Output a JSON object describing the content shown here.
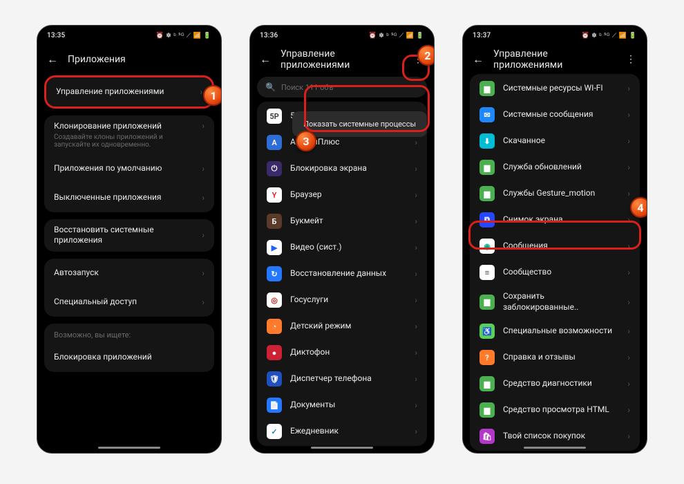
{
  "status_icons": "⏰ ✽ ᵇ ⁵ᴳ ⟋ 📶 🔋",
  "colors": {
    "red": "#d9201a",
    "orange_badge": "#e84a10"
  },
  "screen1": {
    "time": "13:35",
    "title": "Приложения",
    "rows": {
      "manage": "Управление приложениями",
      "clone": "Клонирование приложений",
      "clone_sub": "Создавайте клоны приложений и запускайте их одновременно.",
      "defaults": "Приложения по умолчанию",
      "disabled": "Выключенные приложения",
      "restore": "Восстановить системные приложения",
      "autostart": "Автозапуск",
      "special": "Специальный доступ",
      "hint": "Возможно, вы ищете:",
      "applock": "Блокировка приложений"
    }
  },
  "screen2": {
    "time": "13:36",
    "title": "Управление приложениями",
    "search_placeholder": "Поиск 111 объ",
    "popup": "Показать системные процессы",
    "apps": [
      {
        "name": "5Post",
        "bg": "#fff",
        "fg": "#333",
        "glyph": "5P"
      },
      {
        "name": "АптекиПлюс",
        "bg": "#2e6cd6",
        "fg": "#fff",
        "glyph": "А"
      },
      {
        "name": "Блокировка экрана",
        "bg": "#3b2a6b",
        "fg": "#fff",
        "glyph": "⏻"
      },
      {
        "name": "Браузер",
        "bg": "#fff",
        "fg": "#d22",
        "glyph": "Y"
      },
      {
        "name": "Букмейт",
        "bg": "#5b3a2a",
        "fg": "#fff",
        "glyph": "Б"
      },
      {
        "name": "Видео (сист.)",
        "bg": "#fff",
        "fg": "#1e60ff",
        "glyph": "▶"
      },
      {
        "name": "Восстановление данных",
        "bg": "#2477ff",
        "fg": "#fff",
        "glyph": "↻"
      },
      {
        "name": "Госуслуги",
        "bg": "#fff",
        "fg": "#c22",
        "glyph": "◎"
      },
      {
        "name": "Детский режим",
        "bg": "#ff7a2a",
        "fg": "#fff",
        "glyph": "◔"
      },
      {
        "name": "Диктофон",
        "bg": "#c23",
        "fg": "#fff",
        "glyph": "●"
      },
      {
        "name": "Диспетчер телефона",
        "bg": "#2050c0",
        "fg": "#fff",
        "glyph": "🛡"
      },
      {
        "name": "Документы",
        "bg": "#2477ff",
        "fg": "#fff",
        "glyph": "📄"
      },
      {
        "name": "Ежедневник",
        "bg": "#fff",
        "fg": "#28a",
        "glyph": "✓"
      }
    ]
  },
  "screen3": {
    "time": "13:37",
    "title": "Управление приложениями",
    "apps": [
      {
        "name": "Системные ресурсы WI-FI",
        "bg": "#4caf50",
        "fg": "#fff",
        "glyph": "▆"
      },
      {
        "name": "Системные сообщения",
        "bg": "#1e88ff",
        "fg": "#fff",
        "glyph": "✉"
      },
      {
        "name": "Скачанное",
        "bg": "#00bcd4",
        "fg": "#fff",
        "glyph": "⬇"
      },
      {
        "name": "Служба обновлений",
        "bg": "#4caf50",
        "fg": "#fff",
        "glyph": "▆"
      },
      {
        "name": "Службы Gesture_motion",
        "bg": "#4caf50",
        "fg": "#fff",
        "glyph": "▆"
      },
      {
        "name": "Снимок экрана",
        "bg": "#2747ff",
        "fg": "#fff",
        "glyph": "⧉"
      },
      {
        "name": "Сообщения",
        "bg": "#fff",
        "fg": "#0a8",
        "glyph": "◉"
      },
      {
        "name": "Сообщество",
        "bg": "#fff",
        "fg": "#444",
        "glyph": "≡"
      },
      {
        "name": "Сохранить заблокированные..",
        "bg": "#4caf50",
        "fg": "#fff",
        "glyph": "▆"
      },
      {
        "name": "Специальные возможности",
        "bg": "#5bcf5b",
        "fg": "#fff",
        "glyph": "♿"
      },
      {
        "name": "Справка и отзывы",
        "bg": "#ff7a2a",
        "fg": "#fff",
        "glyph": "?"
      },
      {
        "name": "Средство диагностики",
        "bg": "#4caf50",
        "fg": "#fff",
        "glyph": "▆"
      },
      {
        "name": "Средство просмотра HTML",
        "bg": "#4caf50",
        "fg": "#fff",
        "glyph": "▆"
      },
      {
        "name": "Твой список покупок",
        "bg": "#b338c7",
        "fg": "#fff",
        "glyph": "🛍"
      }
    ]
  },
  "badges": {
    "b1": "1",
    "b2": "2",
    "b3": "3",
    "b4": "4"
  }
}
